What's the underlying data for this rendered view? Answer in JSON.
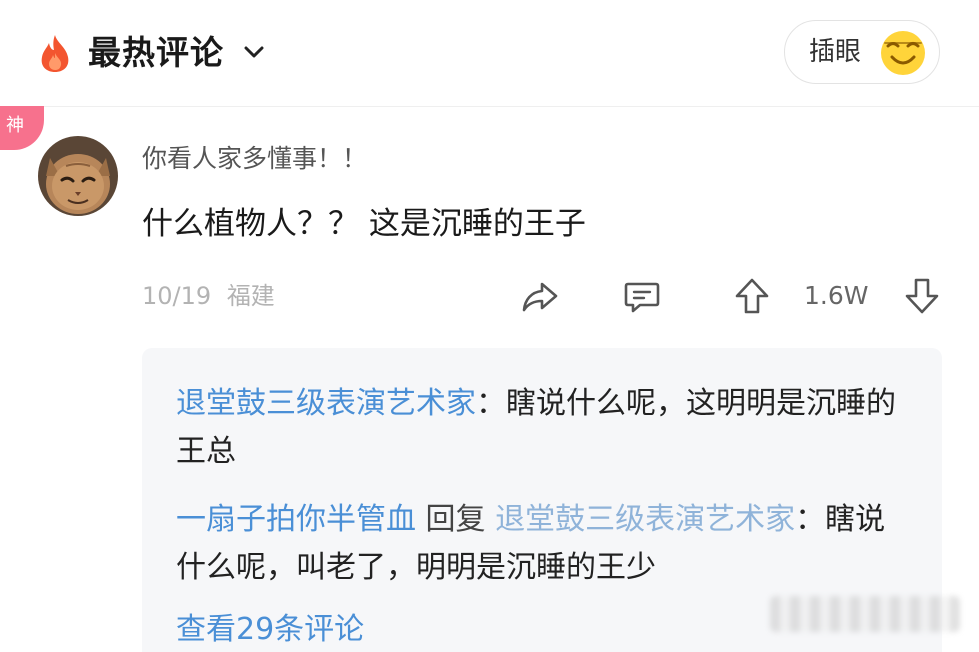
{
  "header": {
    "title": "最热评论",
    "insert_eye_label": "插眼",
    "flame_color": "#f3552f",
    "emoji_color": "#ffd43a"
  },
  "badge": {
    "label": "神",
    "color": "#f7718d"
  },
  "comment": {
    "username": "你看人家多懂事！！",
    "text": "什么植物人？？ 这是沉睡的王子",
    "date": "10/19",
    "location": "福建",
    "like_count": "1.6W"
  },
  "replies": [
    {
      "author": "退堂鼓三级表演艺术家",
      "separator": "：",
      "text": "瞎说什么呢，这明明是沉睡的王总"
    },
    {
      "author": "一扇子拍你半管血",
      "verb": " 回复 ",
      "target": "退堂鼓三级表演艺术家",
      "separator": "：",
      "text": "瞎说什么呢，叫老了，明明是沉睡的王少"
    }
  ],
  "view_more": "查看29条评论",
  "link_color": "#4a8fd6"
}
